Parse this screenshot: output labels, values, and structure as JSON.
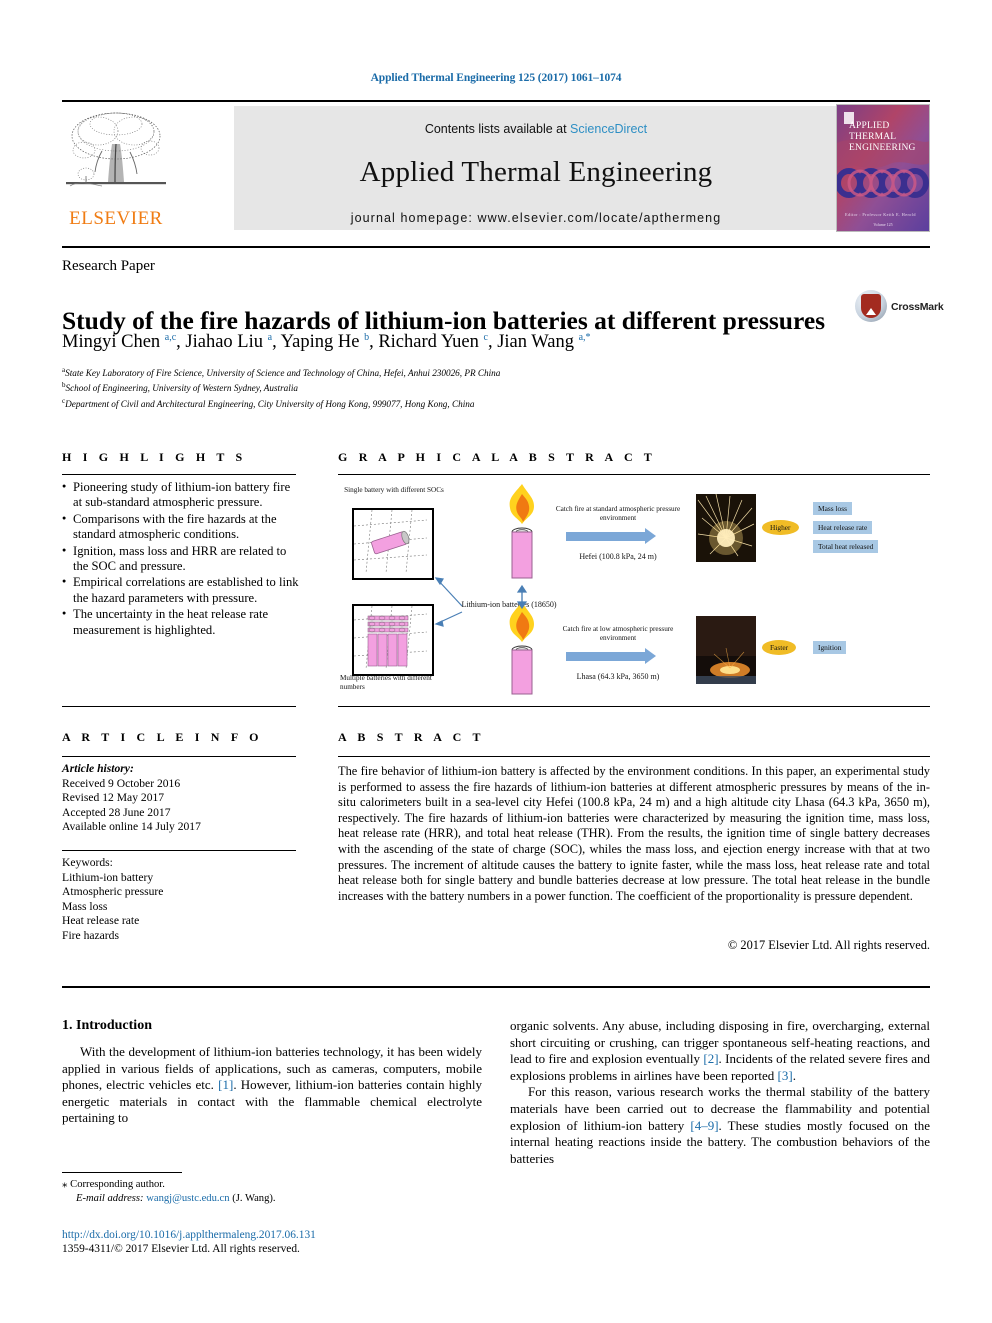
{
  "running_head": "Applied Thermal Engineering 125 (2017) 1061–1074",
  "masthead": {
    "publisher": "ELSEVIER",
    "contents_prefix": "Contents lists available at ",
    "contents_link": "ScienceDirect",
    "journal_title": "Applied Thermal Engineering",
    "homepage": "journal homepage: www.elsevier.com/locate/apthermeng",
    "cover_title_lines": [
      "APPLIED",
      "THERMAL",
      "ENGINEERING"
    ],
    "cover_footer": "Editor : Professor  Keith E. Herold",
    "cover_volume": "Volume 125"
  },
  "article": {
    "type": "Research Paper",
    "title": "Study of the fire hazards of lithium-ion batteries at different pressures",
    "crossmark_label": "CrossMark",
    "authors_html": "Mingyi Chen <sup>a,c</sup>, Jiahao Liu <sup>a</sup>, Yaping He <sup>b</sup>, Richard Yuen <sup>c</sup>, Jian Wang <sup>a,*</sup>",
    "affiliations": [
      {
        "marker": "a",
        "text": "State Key Laboratory of Fire Science, University of Science and Technology of China, Hefei, Anhui 230026, PR China"
      },
      {
        "marker": "b",
        "text": "School of Engineering, University of Western Sydney, Australia"
      },
      {
        "marker": "c",
        "text": "Department of Civil and Architectural Engineering, City University of Hong Kong, 999077, Hong Kong, China"
      }
    ]
  },
  "highlights": {
    "heading": "H I G H L I G H T S",
    "items": [
      "Pioneering study of lithium-ion battery fire at sub-standard atmospheric pressure.",
      "Comparisons with the fire hazards at the standard atmospheric conditions.",
      "Ignition, mass loss and HRR are related to the SOC and pressure.",
      "Empirical correlations are established to link the hazard parameters with pressure.",
      "The uncertainty in the heat release rate measurement is highlighted."
    ]
  },
  "graphical_abstract": {
    "heading": "G R A P H I C A L   A B S T R A C T",
    "labels": {
      "single_battery": "Single battery with different SOCs",
      "multiple_batteries": "Multiple batteries with different numbers",
      "lithium_ion_batteries": "Lithium-ion batteries (18650)",
      "catch_fire_standard": "Catch fire at standard atmospheric pressure environment",
      "catch_fire_low": "Catch fire at low atmospheric pressure environment",
      "hefei": "Hefei (100.8 kPa, 24 m)",
      "lhasa": "Lhasa (64.3 kPa, 3650 m)",
      "higher": "Higher",
      "faster": "Faster",
      "mass_loss": "Mass loss",
      "heat_release_rate": "Heat release rate",
      "total_heat_released": "Total heat released",
      "ignition": "Ignition"
    },
    "colors": {
      "battery_pink": "#f3a0e0",
      "tag_blue": "#a8c8e4",
      "tag_yellow": "#f0bc26",
      "arrow_blue": "#7ba7d7"
    }
  },
  "article_info": {
    "heading": "A R T I C L E   I N F O",
    "history_label": "Article history:",
    "history": [
      "Received 9 October 2016",
      "Revised 12 May 2017",
      "Accepted 28 June 2017",
      "Available online 14 July 2017"
    ],
    "keywords_label": "Keywords:",
    "keywords": [
      "Lithium-ion battery",
      "Atmospheric pressure",
      "Mass loss",
      "Heat release rate",
      "Fire hazards"
    ]
  },
  "abstract": {
    "heading": "A B S T R A C T",
    "text": "The fire behavior of lithium-ion battery is affected by the environment conditions. In this paper, an experimental study is performed to assess the fire hazards of lithium-ion batteries at different atmospheric pressures by means of the in-situ calorimeters built in a sea-level city Hefei (100.8 kPa, 24 m) and a high altitude city Lhasa (64.3 kPa, 3650 m), respectively. The fire hazards of lithium-ion batteries were characterized by measuring the ignition time, mass loss, heat release rate (HRR), and total heat release (THR). From the results, the ignition time of single battery decreases with the ascending of the state of charge (SOC), whiles the mass loss, and ejection energy increase with that at two pressures. The increment of altitude causes the battery to ignite faster, while the mass loss, heat release rate and total heat release both for single battery and bundle batteries decrease at low pressure. The total heat release in the bundle increases with the battery numbers in a power function. The coefficient of the proportionality is pressure dependent.",
    "copyright": "© 2017 Elsevier Ltd. All rights reserved."
  },
  "body": {
    "section_number_title": "1. Introduction",
    "left_paragraphs": [
      "With the development of lithium-ion batteries technology, it has been widely applied in various fields of applications, such as cameras, computers, mobile phones, electric vehicles etc. [1]. However, lithium-ion batteries contain highly energetic materials in contact with the flammable chemical electrolyte pertaining to"
    ],
    "right_paragraphs": [
      "organic solvents. Any abuse, including disposing in fire, overcharging, external short circuiting or crushing, can trigger spontaneous self-heating reactions, and lead to fire and explosion eventually [2]. Incidents of the related severe fires and explosions problems in airlines have been reported [3].",
      "For this reason, various research works the thermal stability of the battery materials have been carried out to decrease the flammability and potential explosion of lithium-ion battery [4–9]. These studies mostly focused on the internal heating reactions inside the battery. The combustion behaviors of the batteries"
    ],
    "citations": [
      "[1]",
      "[2]",
      "[3]",
      "[4–9]"
    ]
  },
  "footer": {
    "corresponding_marker": "⁎",
    "corresponding_author": "Corresponding author.",
    "email_label": "E-mail address:",
    "email": "wangj@ustc.edu.cn",
    "email_owner": "(J. Wang).",
    "doi_url": "http://dx.doi.org/10.1016/j.applthermaleng.2017.06.131",
    "issn_line": "1359-4311/© 2017 Elsevier Ltd. All rights reserved."
  }
}
